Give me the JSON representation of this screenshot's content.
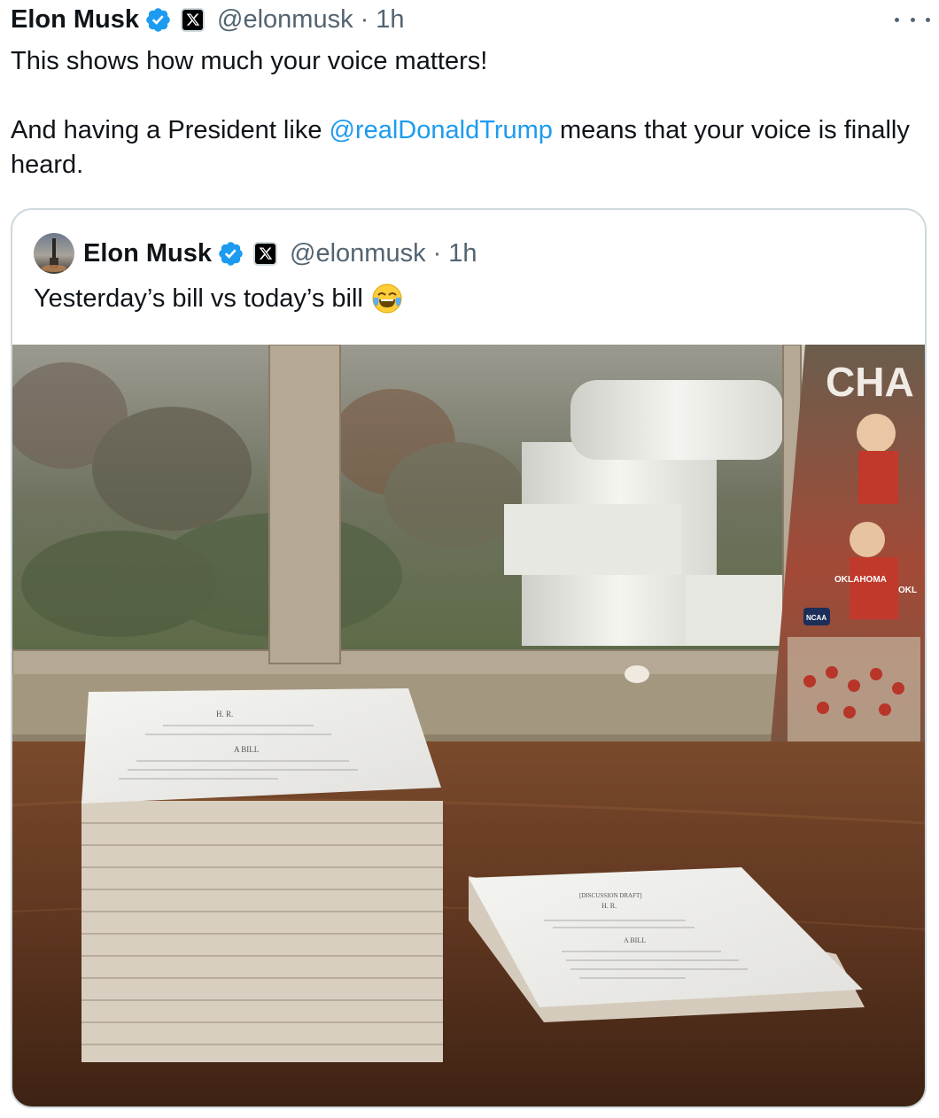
{
  "tweet": {
    "author_name": "Elon Musk",
    "handle": "@elonmusk",
    "separator": "·",
    "time": "1h",
    "text_line1": "This shows how much your voice matters!",
    "text_line2_before": "And having a President like ",
    "mention": "@realDonaldTrump",
    "text_line2_after": " means that your voice is finally heard."
  },
  "quoted": {
    "author_name": "Elon Musk",
    "handle": "@elonmusk",
    "separator": "·",
    "time": "1h",
    "text": "Yesterday’s bill vs today’s bill"
  },
  "icons": {
    "verified": "verified-badge-icon",
    "x_logo": "x-logo-icon",
    "more": "more-options-icon",
    "emoji": "face-with-tears-of-joy-icon"
  },
  "colors": {
    "text": "#0f1419",
    "secondary": "#536471",
    "link": "#1d9bf0",
    "border": "#cfd9de"
  },
  "photo": {
    "bill_header_big": "H. R.",
    "bill_title_big": "A BILL",
    "bill_draft_small": "[DISCUSSION DRAFT]",
    "bill_header_small": "H. R.",
    "bill_title_small": "A BILL",
    "poster_text_top": "CHA",
    "poster_jersey_1": "OKLAHOMA",
    "poster_jersey_2": "OKL",
    "poster_logo": "NCAA"
  }
}
